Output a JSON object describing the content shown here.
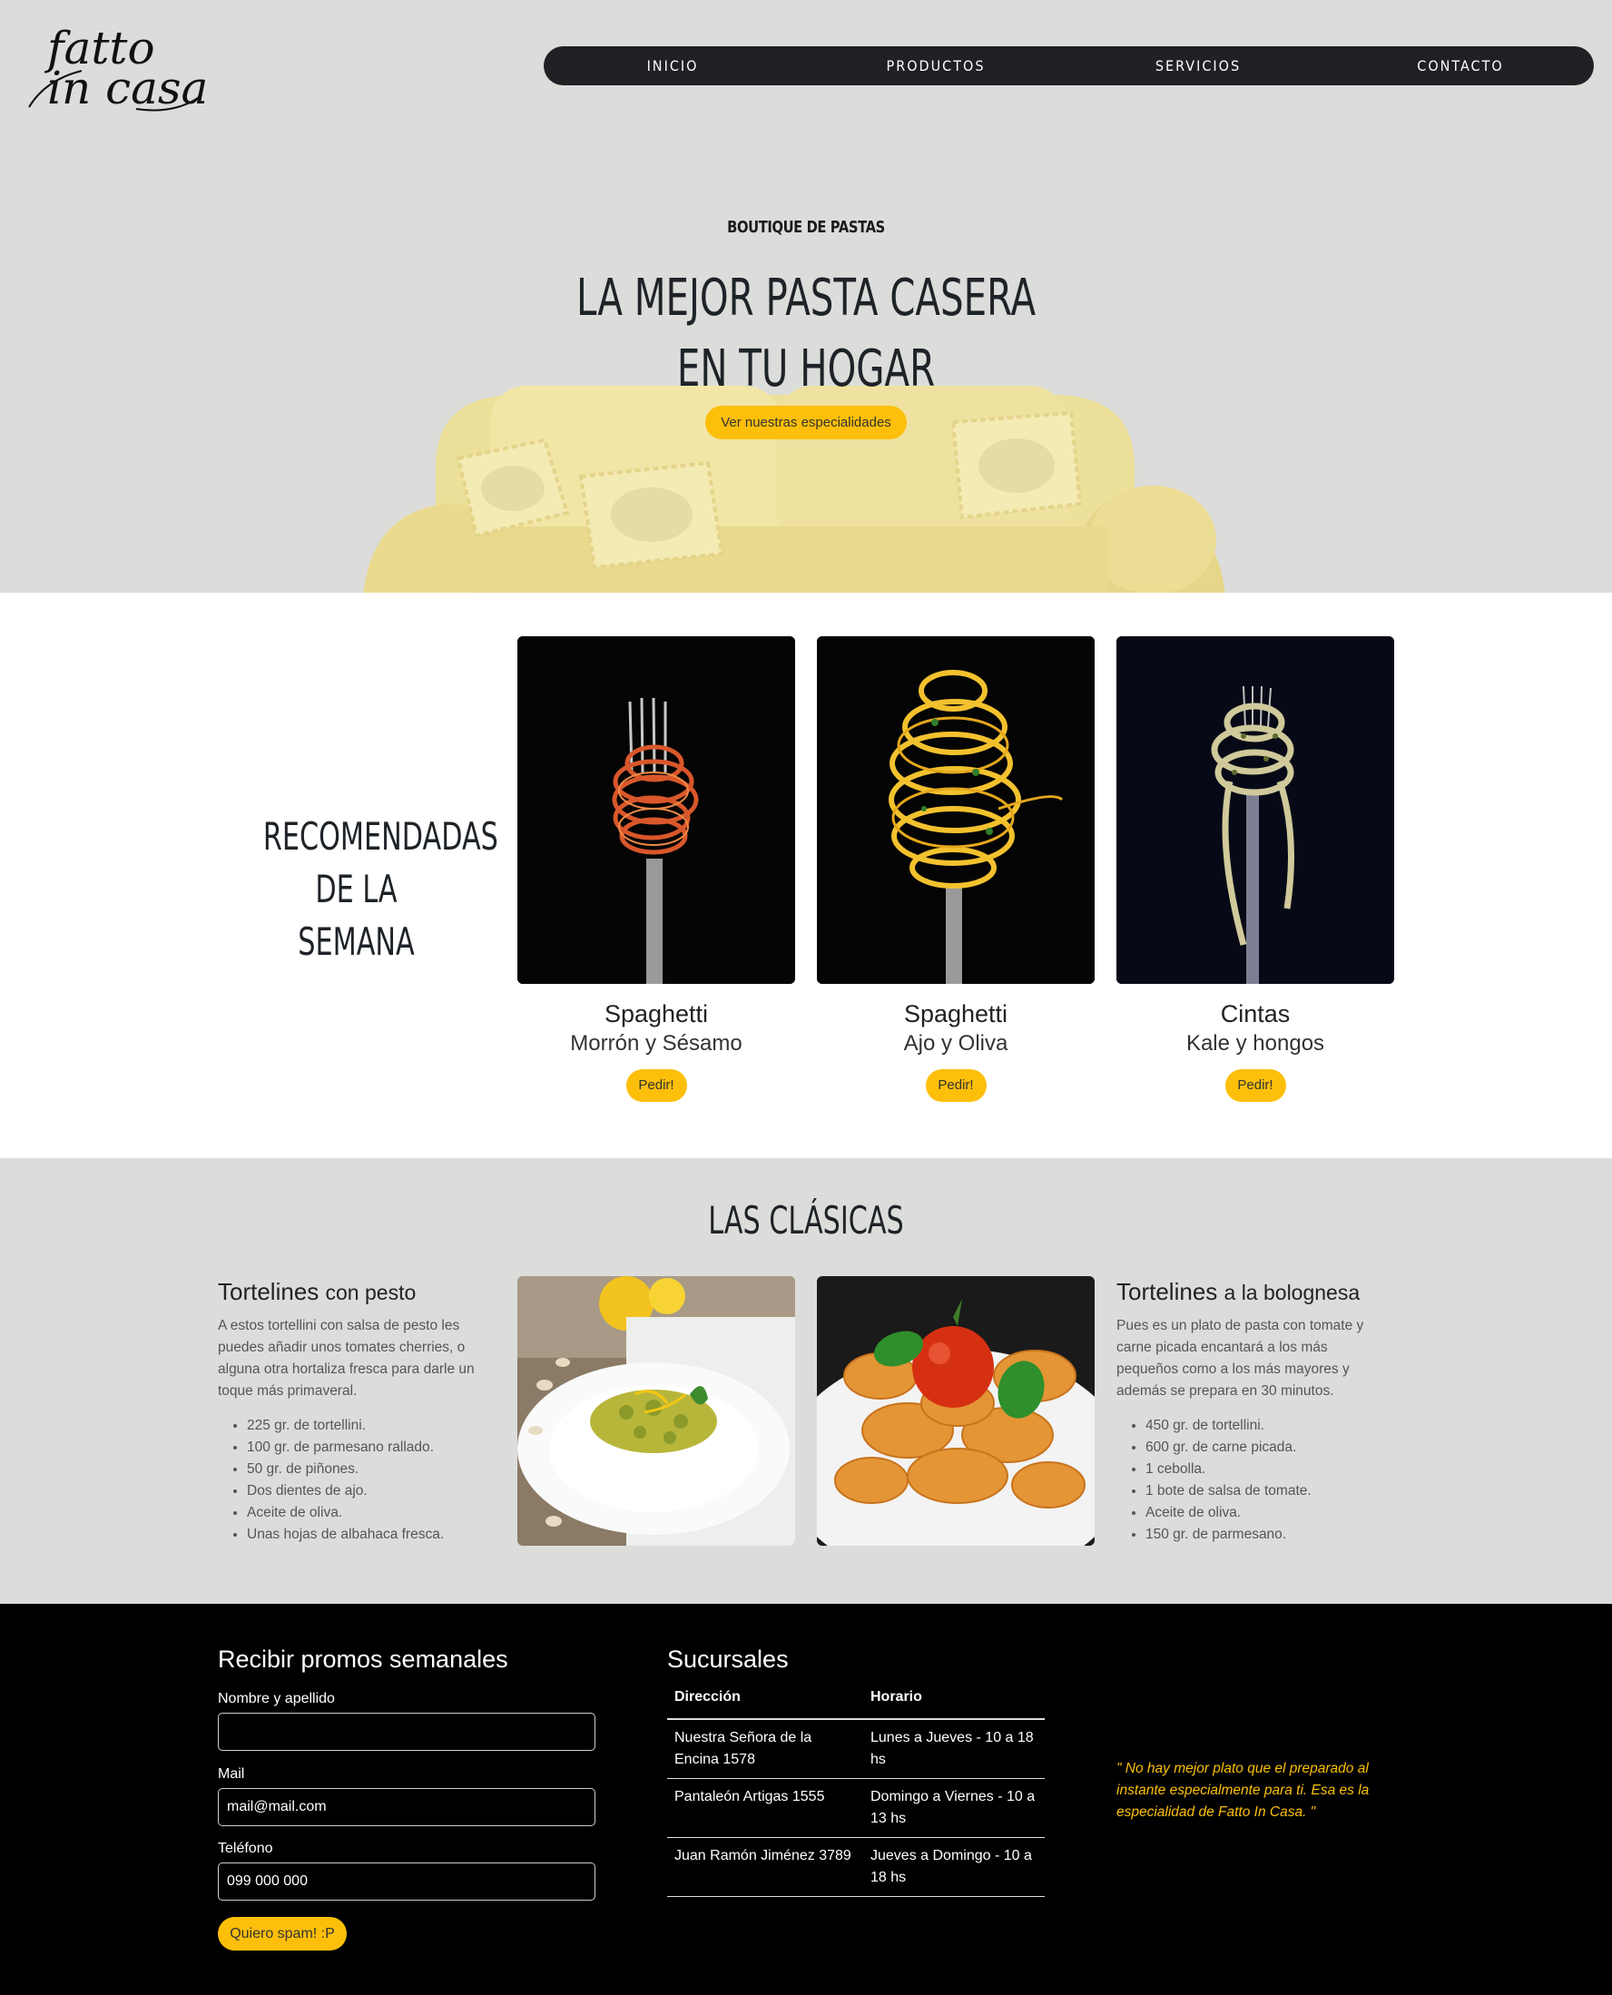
{
  "logo": {
    "line1": "fatto",
    "line2": "in casa"
  },
  "nav": {
    "items": [
      "INICIO",
      "PRODUCTOS",
      "SERVICIOS",
      "CONTACTO"
    ]
  },
  "hero": {
    "subtitle": "BOUTIQUE DE PASTAS",
    "title_line1": "LA MEJOR PASTA CASERA",
    "title_line2": "EN TU HOGAR",
    "button": "Ver nuestras especialidades"
  },
  "recomendadas": {
    "title_line1": "RECOMENDADAS",
    "title_line2": "DE LA SEMANA",
    "cards": [
      {
        "name": "Spaghetti",
        "desc": "Morrón y Sésamo",
        "button": "Pedir!"
      },
      {
        "name": "Spaghetti",
        "desc": "Ajo y Oliva",
        "button": "Pedir!"
      },
      {
        "name": "Cintas",
        "desc": "Kale y hongos",
        "button": "Pedir!"
      }
    ]
  },
  "clasicas": {
    "title": "LAS CLÁSICAS",
    "recipes": [
      {
        "title_main": "Tortelines",
        "title_rest": "con pesto",
        "text": "A estos tortellini con salsa de pesto les puedes añadir unos tomates cherries, o alguna otra hortaliza fresca para darle un toque más primaveral.",
        "ingredients": [
          "225 gr. de tortellini.",
          "100 gr. de parmesano rallado.",
          "50 gr. de piñones.",
          "Dos dientes de ajo.",
          "Aceite de oliva.",
          "Unas hojas de albahaca fresca."
        ]
      },
      {
        "title_main": "Tortelines",
        "title_rest": "a la bolognesa",
        "text": "Pues es un plato de pasta con tomate y carne picada encantará a los más pequeños como a los más mayores y además se prepara en 30 minutos.",
        "ingredients": [
          "450 gr. de tortellini.",
          "600 gr. de carne picada.",
          "1 cebolla.",
          "1 bote de salsa de tomate.",
          "Aceite de oliva.",
          "150 gr. de parmesano."
        ]
      }
    ]
  },
  "footer": {
    "promo_title": "Recibir promos semanales",
    "name_label": "Nombre y apellido",
    "name_value": "",
    "mail_label": "Mail",
    "mail_value": "mail@mail.com",
    "phone_label": "Teléfono",
    "phone_value": "099 000 000",
    "button": "Quiero spam! :P",
    "branches_title": "Sucursales",
    "table_headers": [
      "Dirección",
      "Horario"
    ],
    "branches": [
      {
        "address": "Nuestra Señora de la Encina 1578",
        "hours": "Lunes a Jueves - 10 a 18 hs"
      },
      {
        "address": "Pantaleón Artigas 1555",
        "hours": "Domingo a Viernes - 10 a 13 hs"
      },
      {
        "address": "Juan Ramón Jiménez 3789",
        "hours": "Jueves a Domingo - 10 a 18 hs"
      }
    ],
    "quote": "\" No hay mejor plato que el preparado al instante especialmente para ti. Esa es la especialidad de Fatto In Casa. \""
  },
  "colors": {
    "accent": "#fdbf0a",
    "nav_bg": "#1f2124",
    "hero_bg": "#dcdddb",
    "footer_bg": "#000000"
  }
}
